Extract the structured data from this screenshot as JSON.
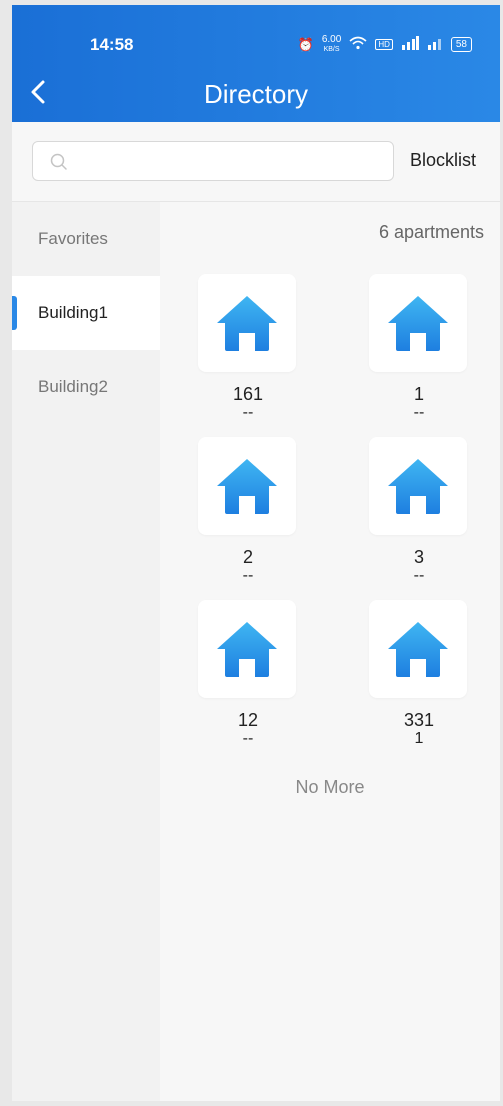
{
  "status_bar": {
    "time": "14:58",
    "speed": "6.00",
    "speed_unit": "KB/S",
    "battery": "58"
  },
  "header": {
    "title": "Directory"
  },
  "search": {
    "placeholder": "",
    "value": "",
    "blocklist_label": "Blocklist"
  },
  "sidebar": {
    "items": [
      {
        "label": "Favorites"
      },
      {
        "label": "Building1"
      },
      {
        "label": "Building2"
      }
    ],
    "active_index": 1
  },
  "main": {
    "count_label": "6 apartments",
    "apartments": [
      {
        "number": "161",
        "sub": "--"
      },
      {
        "number": "1",
        "sub": "--"
      },
      {
        "number": "2",
        "sub": "--"
      },
      {
        "number": "3",
        "sub": "--"
      },
      {
        "number": "12",
        "sub": "--"
      },
      {
        "number": "331",
        "sub": "1"
      }
    ],
    "footer": "No More"
  },
  "colors": {
    "accent": "#2a88e6",
    "house_icon_top": "#3fb6f2",
    "house_icon_bottom": "#1e7fe0"
  }
}
